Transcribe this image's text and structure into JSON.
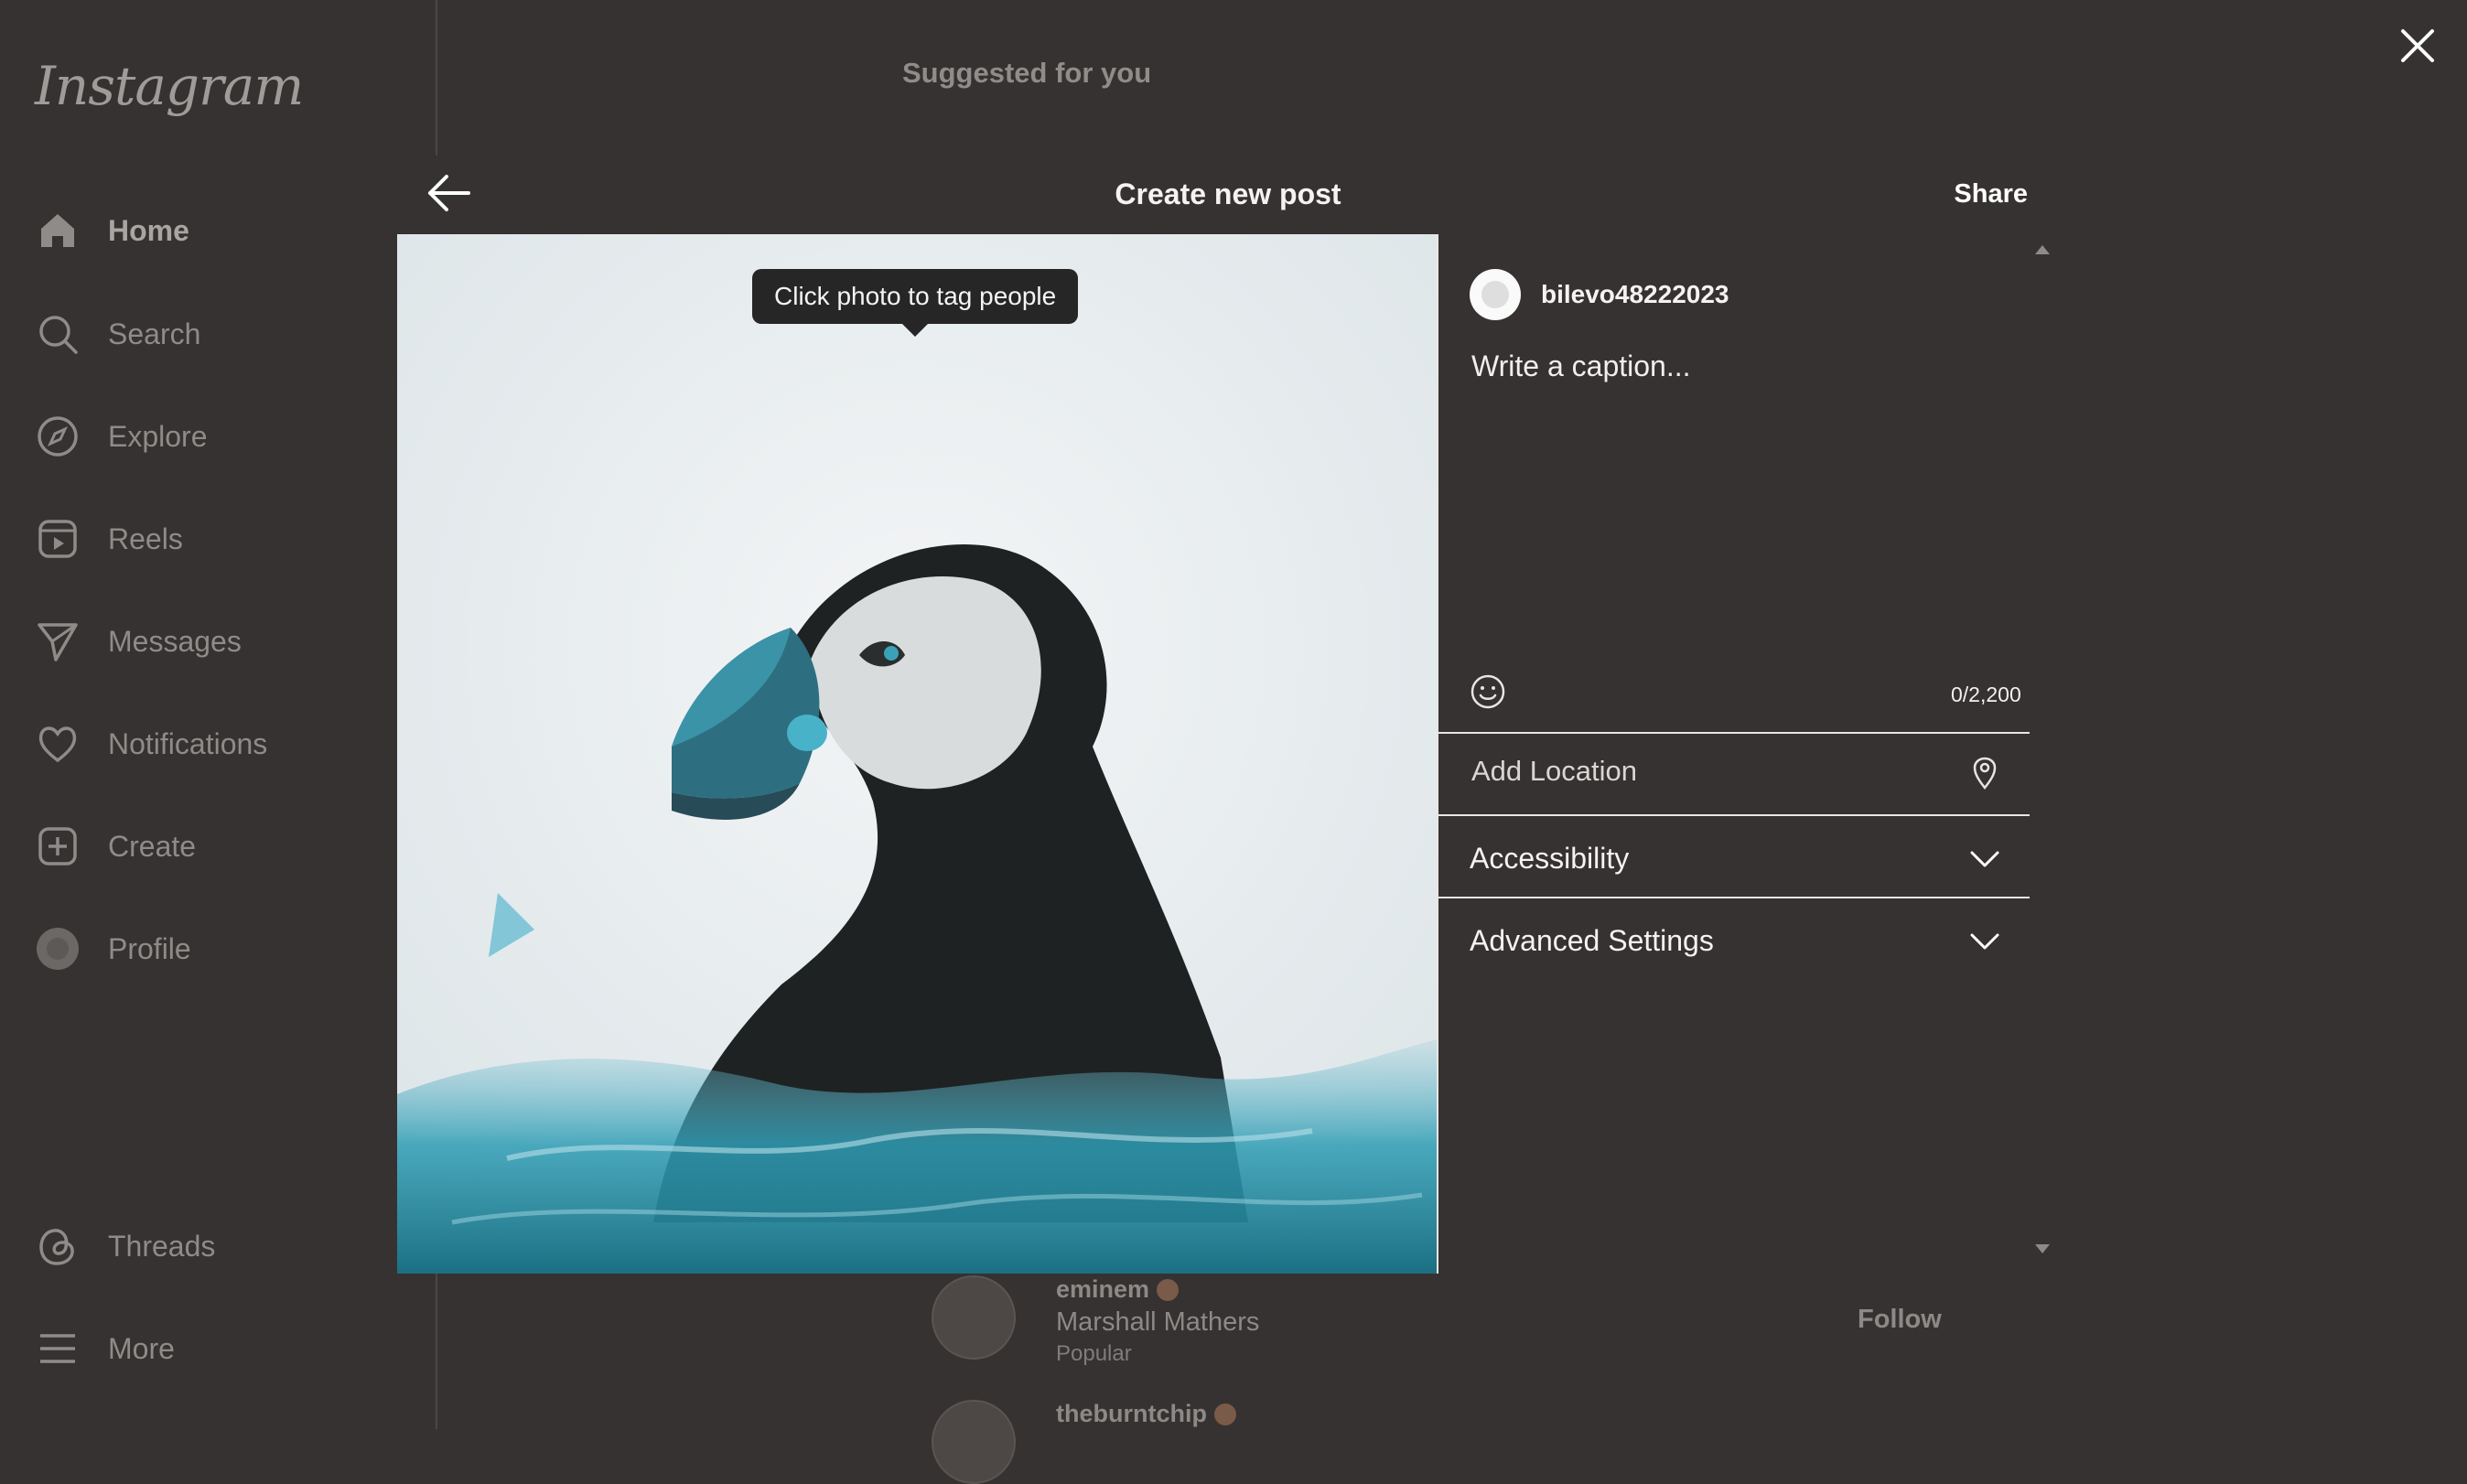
{
  "sidebar": {
    "logo": "Instagram",
    "items": [
      {
        "label": "Home",
        "icon": "home-icon"
      },
      {
        "label": "Search",
        "icon": "search-icon"
      },
      {
        "label": "Explore",
        "icon": "compass-icon"
      },
      {
        "label": "Reels",
        "icon": "reels-icon"
      },
      {
        "label": "Messages",
        "icon": "send-icon"
      },
      {
        "label": "Notifications",
        "icon": "heart-icon"
      },
      {
        "label": "Create",
        "icon": "plus-square-icon"
      },
      {
        "label": "Profile",
        "icon": "avatar-icon"
      },
      {
        "label": "Threads",
        "icon": "threads-icon"
      },
      {
        "label": "More",
        "icon": "hamburger-icon"
      }
    ]
  },
  "feed": {
    "suggested_title": "Suggested for you",
    "suggestions": [
      {
        "username": "eminem",
        "name": "Marshall Mathers",
        "sub": "Popular",
        "follow": "Follow"
      },
      {
        "username": "theburntchip"
      }
    ]
  },
  "modal": {
    "title": "Create new post",
    "share": "Share",
    "tooltip": "Click photo to tag people",
    "username": "bilevo48222023",
    "caption_placeholder": "Write a caption...",
    "char_count": "0/2,200",
    "location_placeholder": "Add Location",
    "accessibility": "Accessibility",
    "advanced": "Advanced Settings"
  },
  "colors": {
    "background": "#353231",
    "modal_text": "#f5f3f2",
    "puffin_accent": "#2f9db5"
  }
}
